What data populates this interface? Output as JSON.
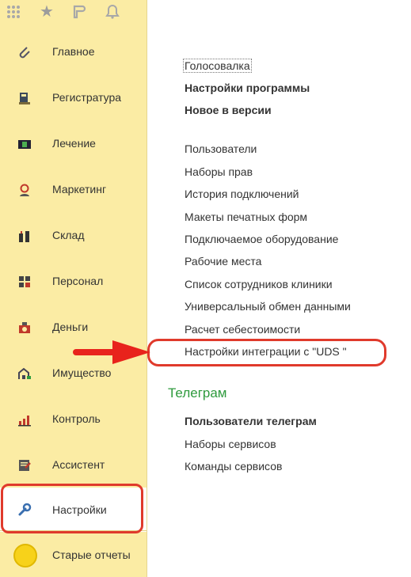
{
  "colors": {
    "sidebar_bg": "#fbeca4",
    "accent_red": "#e03a2c",
    "section_green": "#2e9a3d"
  },
  "topbar": {
    "icons": [
      "apps-grid-icon",
      "star-icon",
      "history-icon",
      "bell-icon"
    ]
  },
  "sidebar": {
    "items": [
      {
        "label": "Главное",
        "icon": "paperclip-icon"
      },
      {
        "label": "Регистратура",
        "icon": "reception-icon"
      },
      {
        "label": "Лечение",
        "icon": "treatment-icon"
      },
      {
        "label": "Маркетинг",
        "icon": "marketing-icon"
      },
      {
        "label": "Склад",
        "icon": "warehouse-icon"
      },
      {
        "label": "Персонал",
        "icon": "staff-icon"
      },
      {
        "label": "Деньги",
        "icon": "money-icon"
      },
      {
        "label": "Имущество",
        "icon": "property-icon"
      },
      {
        "label": "Контроль",
        "icon": "chart-icon"
      },
      {
        "label": "Ассистент",
        "icon": "assistant-icon"
      },
      {
        "label": "Настройки",
        "icon": "wrench-icon",
        "active": true
      },
      {
        "label": "Старые отчеты",
        "icon": "circle-icon"
      }
    ]
  },
  "main": {
    "top_links": [
      "Голосовалка",
      "Настройки программы",
      "Новое в версии"
    ],
    "links": [
      "Пользователи",
      "Наборы прав",
      "История подключений",
      "Макеты печатных форм",
      "Подключаемое оборудование",
      "Рабочие места",
      "Список сотрудников клиники",
      "Универсальный обмен данными",
      "Расчет себестоимости",
      "Настройки интеграции с \"UDS \""
    ],
    "telegram": {
      "title": "Телеграм",
      "links": [
        "Пользователи телеграм",
        "Наборы сервисов",
        "Команды сервисов"
      ]
    }
  }
}
